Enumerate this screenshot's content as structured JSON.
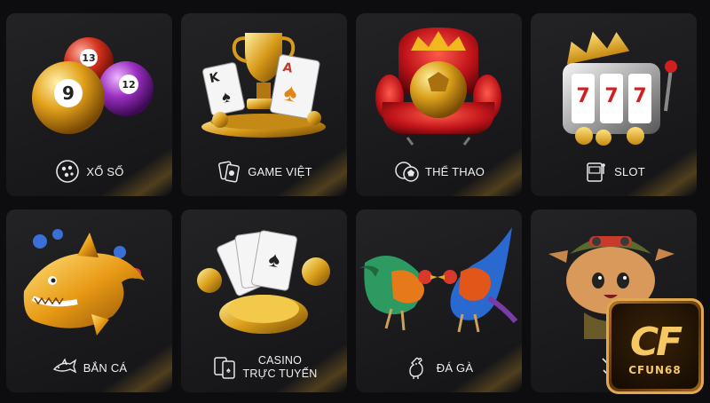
{
  "tiles": [
    {
      "label": "XỔ SỐ",
      "icon": "lottery-ball-icon"
    },
    {
      "label": "GAME VIỆT",
      "icon": "playing-cards-icon"
    },
    {
      "label": "THỂ THAO",
      "icon": "soccer-ball-icon"
    },
    {
      "label": "SLOT",
      "icon": "slot-machine-icon"
    },
    {
      "label": "BẮN CÁ",
      "icon": "shark-icon"
    },
    {
      "label_line1": "CASINO",
      "label_line2": "TRỰC TUYẾN",
      "icon": "cards-icon"
    },
    {
      "label": "ĐÁ GÀ",
      "icon": "rooster-icon"
    },
    {
      "label": "",
      "icon": "crossed-swords-icon"
    }
  ],
  "logo": {
    "mark": "CF",
    "word": "CFUN68"
  },
  "colors": {
    "tile_bg": "#1b1b1e",
    "gold": "#f6c862",
    "text": "#f0f0f0"
  }
}
